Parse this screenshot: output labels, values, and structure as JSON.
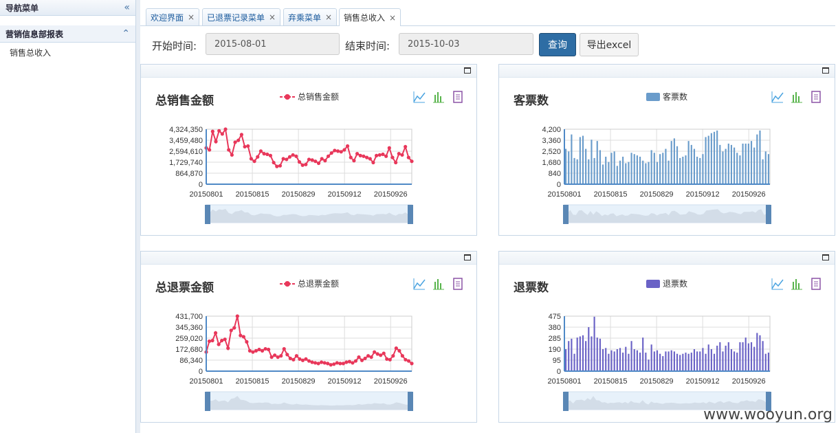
{
  "sidebar": {
    "title": "导航菜单",
    "section": "营销信息部报表",
    "items": [
      "销售总收入"
    ]
  },
  "tabs": [
    {
      "label": "欢迎界面",
      "active": false
    },
    {
      "label": "已退票记录菜单",
      "active": false
    },
    {
      "label": "弃乘菜单",
      "active": false
    },
    {
      "label": "销售总收入",
      "active": true
    }
  ],
  "toolbar": {
    "start_label": "开始时间:",
    "start_value": "2015-08-01",
    "end_label": "结束时间:",
    "end_value": "2015-10-03",
    "query_label": "查询",
    "export_label": "导出excel"
  },
  "colors": {
    "red": "#e8375a",
    "blue": "#6a9ccb",
    "purple": "#6a62c6",
    "accent": "#2e6da4"
  },
  "watermark": "www.wooyun.org",
  "chart_data": [
    {
      "type": "line",
      "title": "总销售金额",
      "series": [
        {
          "name": "总销售金额",
          "values": [
            2850000,
            2700000,
            4150000,
            3350000,
            4200000,
            3950000,
            4324350,
            2700000,
            2300000,
            3300000,
            3450000,
            3900000,
            2950000,
            3000000,
            2000000,
            1800000,
            2150000,
            2600000,
            2400000,
            2350000,
            2250000,
            1700000,
            1400000,
            1450000,
            2000000,
            1950000,
            2150000,
            2300000,
            2200000,
            1750000,
            1500000,
            1550000,
            1950000,
            1900000,
            1800000,
            1650000,
            2000000,
            1850000,
            2200000,
            2450000,
            2650000,
            2600000,
            2550000,
            2700000,
            3000000,
            2100000,
            1850000,
            2400000,
            2250000,
            2200000,
            2100000,
            2000000,
            1700000,
            2250000,
            2300000,
            2350000,
            2200000,
            2850000,
            2100000,
            1700000,
            2400000,
            2300000,
            2950000,
            2100000,
            1800000
          ]
        }
      ],
      "x_ticks": [
        "20150801",
        "20150815",
        "20150829",
        "20150912",
        "20150926"
      ],
      "y_ticks": [
        "4,324,350",
        "3,459,480",
        "2,594,610",
        "1,729,740",
        "864,870",
        "0"
      ],
      "ylim": [
        0,
        4324350
      ]
    },
    {
      "type": "bar",
      "title": "客票数",
      "series": [
        {
          "name": "客票数",
          "values": [
            2700,
            2500,
            3800,
            2000,
            1900,
            3600,
            3700,
            2700,
            1900,
            3400,
            2000,
            3300,
            2600,
            1500,
            2100,
            1700,
            2400,
            2500,
            1400,
            1800,
            2100,
            1600,
            1700,
            2400,
            2300,
            2200,
            2100,
            1800,
            1600,
            1700,
            2600,
            2400,
            1700,
            2300,
            2400,
            2700,
            1800,
            3300,
            3500,
            2900,
            2000,
            2100,
            2200,
            3300,
            3000,
            2700,
            2100,
            2000,
            2300,
            3600,
            3700,
            3900,
            4000,
            4100,
            3000,
            2500,
            2700,
            3100,
            3000,
            2800,
            2400,
            2200,
            3100,
            3100,
            3100,
            3300,
            2800,
            3800,
            4100,
            1900,
            2500,
            2300
          ]
        }
      ],
      "x_ticks": [
        "20150801",
        "20150815",
        "20150829",
        "20150912",
        "20150926"
      ],
      "y_ticks": [
        "4,200",
        "3,360",
        "2,520",
        "1,680",
        "840",
        "0"
      ],
      "ylim": [
        0,
        4200
      ]
    },
    {
      "type": "line",
      "title": "总退票金额",
      "series": [
        {
          "name": "总退票金额",
          "values": [
            150000,
            235000,
            240000,
            300000,
            210000,
            240000,
            250000,
            180000,
            320000,
            340000,
            431700,
            280000,
            270000,
            230000,
            160000,
            150000,
            160000,
            170000,
            160000,
            175000,
            170000,
            110000,
            125000,
            110000,
            120000,
            175000,
            130000,
            100000,
            90000,
            120000,
            95000,
            85000,
            95000,
            80000,
            70000,
            65000,
            60000,
            70000,
            65000,
            60000,
            50000,
            55000,
            65000,
            60000,
            60000,
            70000,
            75000,
            65000,
            80000,
            110000,
            85000,
            100000,
            120000,
            110000,
            150000,
            135000,
            125000,
            140000,
            95000,
            90000,
            120000,
            180000,
            160000,
            120000,
            90000,
            80000,
            60000
          ]
        }
      ],
      "x_ticks": [
        "20150801",
        "20150815",
        "20150829",
        "20150912",
        "20150926"
      ],
      "y_ticks": [
        "431,700",
        "345,360",
        "259,020",
        "172,680",
        "86,340",
        "0"
      ],
      "ylim": [
        0,
        431700
      ]
    },
    {
      "type": "bar",
      "title": "退票数",
      "series": [
        {
          "name": "退票数",
          "values": [
            190,
            260,
            280,
            150,
            290,
            300,
            310,
            260,
            380,
            300,
            470,
            290,
            280,
            190,
            200,
            150,
            180,
            170,
            190,
            200,
            160,
            210,
            150,
            260,
            190,
            180,
            160,
            290,
            160,
            100,
            230,
            170,
            180,
            150,
            130,
            170,
            170,
            180,
            170,
            150,
            140,
            150,
            160,
            150,
            160,
            190,
            170,
            170,
            200,
            150,
            230,
            190,
            150,
            220,
            250,
            170,
            220,
            250,
            190,
            170,
            160,
            250,
            250,
            290,
            240,
            250,
            210,
            330,
            310,
            260,
            150,
            160
          ]
        }
      ],
      "x_ticks": [
        "20150801",
        "20150815",
        "20150829",
        "20150912",
        "20150926"
      ],
      "y_ticks": [
        "475",
        "380",
        "285",
        "190",
        "95",
        "0"
      ],
      "ylim": [
        0,
        475
      ]
    }
  ]
}
